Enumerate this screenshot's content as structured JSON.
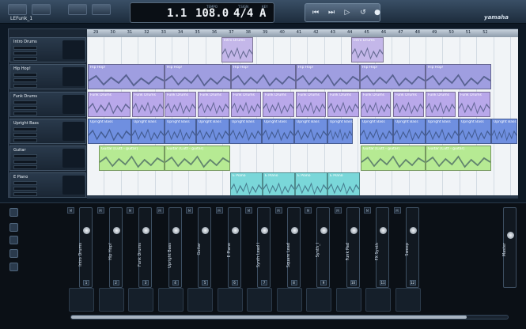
{
  "app": {
    "song_name": "LEFunk_1",
    "brand": "yamaha"
  },
  "transport": {
    "position": "1.1",
    "tempo": "108.0",
    "time_signature": "4/4",
    "key": "A",
    "labels": [
      "TEMPO",
      "T.SIGN",
      "KEY"
    ]
  },
  "ruler": {
    "bars": [
      "29",
      "30",
      "31",
      "32",
      "33",
      "34",
      "35",
      "36",
      "37",
      "38",
      "39",
      "40",
      "41",
      "42",
      "43",
      "44",
      "45",
      "46",
      "47",
      "48",
      "49",
      "50",
      "51",
      "52"
    ]
  },
  "tracks": [
    {
      "name": "Intro Drums",
      "parts": [
        {
          "label": "Intro Drums",
          "start": 280,
          "end": 320,
          "color": "#c4b7e9"
        },
        {
          "label": "Intro Drums",
          "start": 444,
          "end": 485,
          "color": "#c4b7e9"
        }
      ]
    },
    {
      "name": "Hip Hop!",
      "parts": [
        {
          "label": "Hip Hop!",
          "start": 111,
          "end": 208,
          "color": "#9f9ee0"
        },
        {
          "label": "Hip Hop!",
          "start": 208,
          "end": 292,
          "color": "#9f9ee0"
        },
        {
          "label": "Hip Hop!",
          "start": 292,
          "end": 374,
          "color": "#9f9ee0"
        },
        {
          "label": "Hip Hop!",
          "start": 374,
          "end": 455,
          "color": "#9f9ee0"
        },
        {
          "label": "Hip Hop!",
          "start": 455,
          "end": 538,
          "color": "#9f9ee0"
        },
        {
          "label": "Hip Hop!",
          "start": 538,
          "end": 621,
          "color": "#9f9ee0"
        }
      ]
    },
    {
      "name": "Funk Drums",
      "parts": [
        {
          "label": "Funk Drums",
          "start": 111,
          "end": 165,
          "color": "#b9a8ea"
        },
        {
          "label": "Funk Drums",
          "start": 167,
          "end": 207,
          "color": "#b9a8ea"
        },
        {
          "label": "Funk Drums",
          "start": 208,
          "end": 248,
          "color": "#b9a8ea"
        },
        {
          "label": "Funk Drums",
          "start": 250,
          "end": 290,
          "color": "#b9a8ea"
        },
        {
          "label": "Funk Drums",
          "start": 292,
          "end": 330,
          "color": "#b9a8ea"
        },
        {
          "label": "Funk Drums",
          "start": 332,
          "end": 372,
          "color": "#b9a8ea"
        },
        {
          "label": "Funk Drums",
          "start": 374,
          "end": 412,
          "color": "#b9a8ea"
        },
        {
          "label": "Funk Drums",
          "start": 414,
          "end": 454,
          "color": "#b9a8ea"
        },
        {
          "label": "Funk Drums",
          "start": 456,
          "end": 494,
          "color": "#b9a8ea"
        },
        {
          "label": "Funk Drums",
          "start": 497,
          "end": 536,
          "color": "#b9a8ea"
        },
        {
          "label": "Funk Drums",
          "start": 538,
          "end": 576,
          "color": "#b9a8ea"
        },
        {
          "label": "Funk Drums",
          "start": 579,
          "end": 620,
          "color": "#b9a8ea"
        }
      ]
    },
    {
      "name": "Upright Bass",
      "parts": [
        {
          "label": "Upright Bass",
          "start": 111,
          "end": 166,
          "color": "#6f8fe0"
        },
        {
          "label": "Upright Bass",
          "start": 166,
          "end": 208,
          "color": "#6f8fe0"
        },
        {
          "label": "Upright Bass",
          "start": 208,
          "end": 248,
          "color": "#6f8fe0"
        },
        {
          "label": "Upright Bass",
          "start": 248,
          "end": 290,
          "color": "#6f8fe0"
        },
        {
          "label": "Upright Bass",
          "start": 290,
          "end": 331,
          "color": "#6f8fe0"
        },
        {
          "label": "Upright Bass",
          "start": 331,
          "end": 372,
          "color": "#6f8fe0"
        },
        {
          "label": "Upright Bass",
          "start": 372,
          "end": 414,
          "color": "#6f8fe0"
        },
        {
          "label": "Upright Bass",
          "start": 414,
          "end": 446,
          "color": "#6f8fe0"
        },
        {
          "label": "Upright Bass",
          "start": 455,
          "end": 497,
          "color": "#6f8fe0"
        },
        {
          "label": "Upright Bass",
          "start": 497,
          "end": 538,
          "color": "#6f8fe0"
        },
        {
          "label": "Upright Bass",
          "start": 538,
          "end": 580,
          "color": "#6f8fe0"
        },
        {
          "label": "Upright Bass",
          "start": 580,
          "end": 621,
          "color": "#6f8fe0"
        },
        {
          "label": "Upright Bass",
          "start": 621,
          "end": 654,
          "color": "#6f8fe0"
        }
      ]
    },
    {
      "name": "Guitar",
      "parts": [
        {
          "label": "Guitar [Cutt - guitar]",
          "start": 125,
          "end": 208,
          "color": "#b6ea93"
        },
        {
          "label": "Guitar [Cutt - guitar]",
          "start": 208,
          "end": 291,
          "color": "#b6ea93"
        },
        {
          "label": "Guitar [Cutt - guitar]",
          "start": 456,
          "end": 538,
          "color": "#b6ea93"
        },
        {
          "label": "Guitar [Cutt - guitar]",
          "start": 538,
          "end": 621,
          "color": "#b6ea93"
        }
      ]
    },
    {
      "name": "E Piano",
      "parts": [
        {
          "label": "E Piano",
          "start": 291,
          "end": 332,
          "color": "#7ad7d9"
        },
        {
          "label": "E Piano",
          "start": 332,
          "end": 373,
          "color": "#7ad7d9"
        },
        {
          "label": "E Piano",
          "start": 373,
          "end": 414,
          "color": "#7ad7d9"
        },
        {
          "label": "E Piano",
          "start": 414,
          "end": 455,
          "color": "#7ad7d9"
        }
      ]
    }
  ],
  "mixer": {
    "channels": [
      "Intro Drums",
      "Hip Hop!",
      "Funk Drums",
      "Upright Bass",
      "Guitar",
      "E Piano",
      "Synth Lead I",
      "Square Lead",
      "Synth_I",
      "Funk Pad",
      "FX Synth",
      "Sweep"
    ],
    "numbers": [
      "1",
      "2",
      "3",
      "4",
      "5",
      "6",
      "7",
      "8",
      "9",
      "10",
      "11",
      "12"
    ],
    "master": "Master",
    "btn": "M"
  }
}
